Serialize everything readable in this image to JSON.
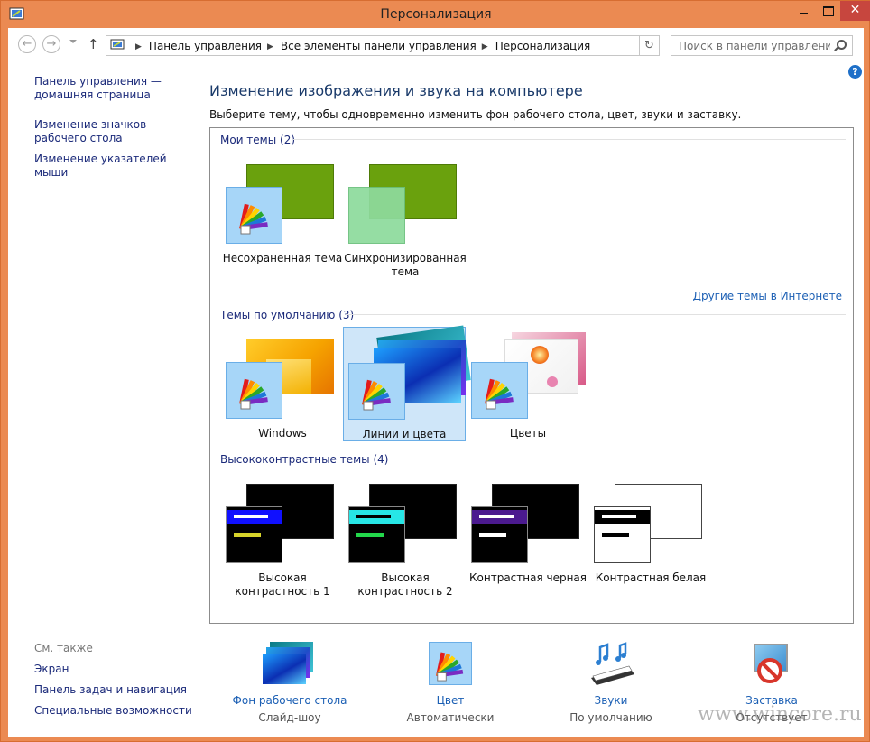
{
  "window": {
    "title": "Персонализация"
  },
  "address_bar": {
    "breadcrumbs": [
      "Панель управления",
      "Все элементы панели управления",
      "Персонализация"
    ],
    "search_placeholder": "Поиск в панели управления"
  },
  "sidebar": {
    "links": [
      "Панель управления — домашняя страница",
      "Изменение значков рабочего стола",
      "Изменение указателей мыши"
    ]
  },
  "see_also": {
    "label": "См. также",
    "links": [
      "Экран",
      "Панель задач и навигация",
      "Специальные возможности"
    ]
  },
  "main": {
    "title": "Изменение изображения и звука на компьютере",
    "subtitle": "Выберите тему, чтобы одновременно изменить фон рабочего стола, цвет, звуки и заставку.",
    "groups": [
      {
        "header": "Мои темы (2)",
        "themes": [
          "Несохраненная тема",
          "Синхронизированная тема"
        ]
      },
      {
        "header": "Темы по умолчанию (3)",
        "themes": [
          "Windows",
          "Линии и цвета",
          "Цветы"
        ]
      },
      {
        "header": "Высококонтрастные темы (4)",
        "themes": [
          "Высокая контрастность 1",
          "Высокая контрастность 2",
          "Контрастная черная",
          "Контрастная белая"
        ]
      }
    ],
    "more_themes_link": "Другие темы в Интернете",
    "selected_theme": "Линии и цвета"
  },
  "bottom": [
    {
      "label": "Фон рабочего стола",
      "value": "Слайд-шоу"
    },
    {
      "label": "Цвет",
      "value": "Автоматически"
    },
    {
      "label": "Звуки",
      "value": "По умолчанию"
    },
    {
      "label": "Заставка",
      "value": "Отсутствует"
    }
  ],
  "watermark": "www.wincore.ru",
  "colors": {
    "frame": "#eb8a52",
    "link": "#1b2a7a",
    "accent_link": "#1b5fb4",
    "selection": "#cfe6f9"
  }
}
